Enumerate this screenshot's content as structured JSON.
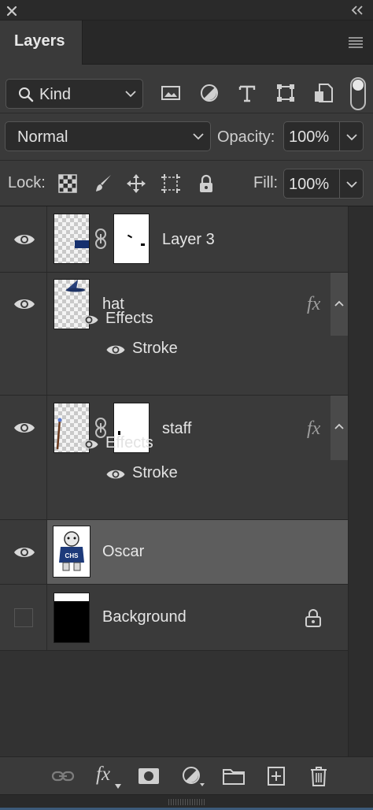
{
  "window": {
    "close_icon": "close-icon",
    "collapse_icon": "double-chevron-left-icon"
  },
  "panel": {
    "tab_label": "Layers",
    "menu_icon": "hamburger-menu-icon"
  },
  "filter": {
    "kind_label": "Kind",
    "icons": [
      "image-filter-icon",
      "adjustment-filter-icon",
      "type-filter-icon",
      "shape-filter-icon",
      "smart-object-filter-icon"
    ],
    "filter_toggle_on": true
  },
  "blend": {
    "mode": "Normal",
    "opacity_label": "Opacity:",
    "opacity_value": "100%",
    "fill_label": "Fill:",
    "fill_value": "100%"
  },
  "lock": {
    "label": "Lock:",
    "icons": [
      "lock-transparent-pixels-icon",
      "lock-image-pixels-icon",
      "lock-position-icon",
      "lock-artboard-icon",
      "lock-all-icon"
    ]
  },
  "layers": [
    {
      "name": "Layer 3",
      "visible": true,
      "has_mask": true,
      "fx": false
    },
    {
      "name": "hat",
      "visible": true,
      "has_mask": false,
      "fx": true,
      "fx_label": "fx",
      "effects_label": "Effects",
      "effects": [
        "Stroke"
      ]
    },
    {
      "name": "staff",
      "visible": true,
      "has_mask": true,
      "fx": true,
      "fx_label": "fx",
      "effects_label": "Effects",
      "effects": [
        "Stroke"
      ]
    },
    {
      "name": "Oscar",
      "visible": true,
      "selected": true,
      "has_mask": false,
      "fx": false,
      "thumb_text": "CHS"
    },
    {
      "name": "Background",
      "visible": false,
      "locked": true,
      "has_mask": false,
      "fx": false
    }
  ],
  "bottom_bar": {
    "fx_label": "fx",
    "icons": [
      "link-layers-icon",
      "layer-style-icon",
      "add-mask-icon",
      "new-adjustment-layer-icon",
      "new-group-icon",
      "new-layer-icon",
      "delete-layer-icon"
    ]
  },
  "colors": {
    "panel_bg": "#3a3a3a",
    "selected_row": "#5d5d5d",
    "dark_bg": "#323232"
  }
}
